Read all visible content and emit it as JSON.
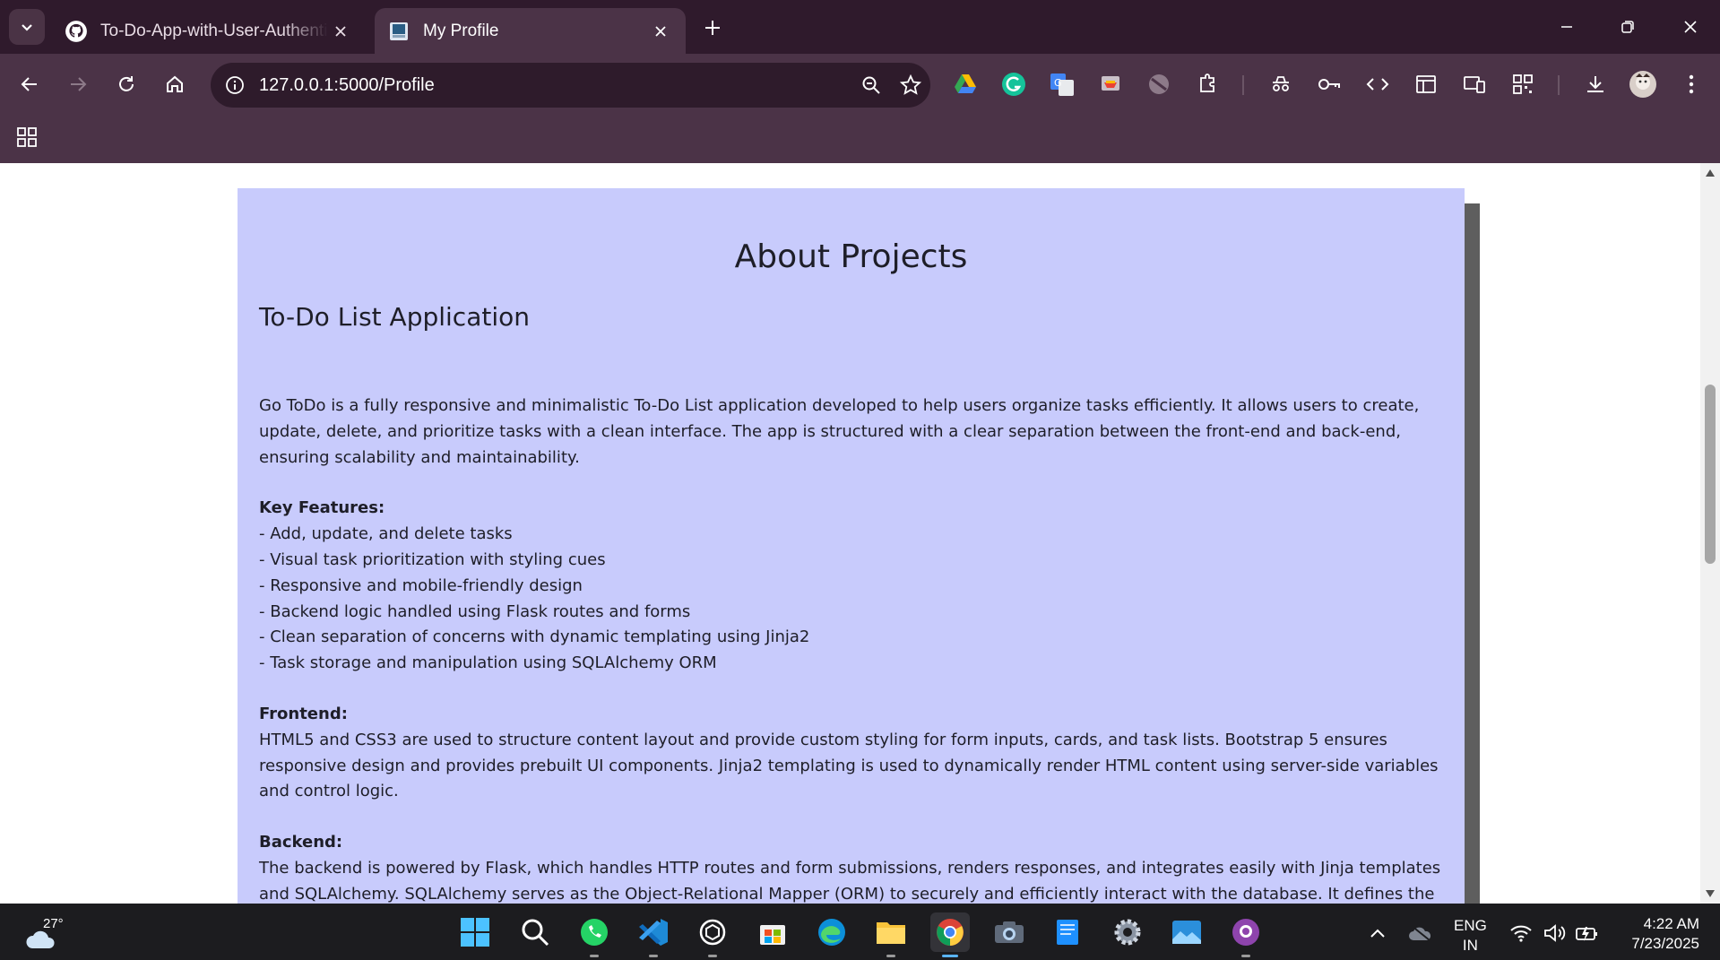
{
  "browser": {
    "tabs": [
      {
        "title": "To-Do-App-with-User-Authentication",
        "favicon": "github-icon",
        "active": false
      },
      {
        "title": "My Profile",
        "favicon": "page-favicon",
        "active": true
      }
    ],
    "url": "127.0.0.1:5000/Profile",
    "extensions": [
      "google-drive-icon",
      "grammarly-icon",
      "google-translate-icon",
      "cast-icon",
      "blocker-icon",
      "extensions-icon",
      "incognito-icon",
      "password-key-icon",
      "code-icon",
      "layout-icon",
      "responsive-icon",
      "qr-code-icon",
      "download-icon",
      "profile-avatar"
    ]
  },
  "page": {
    "heading": "About Projects",
    "project_title": "To-Do List Application",
    "intro": "Go ToDo is a fully responsive and minimalistic To-Do List application developed to help users organize tasks efficiently. It allows users to create, update, delete, and prioritize tasks with a clean interface. The app is structured with a clear separation between the front-end and back-end, ensuring scalability and maintainability.",
    "features_label": "Key Features:",
    "features": [
      "- Add, update, and delete tasks",
      "- Visual task prioritization with styling cues",
      "- Responsive and mobile-friendly design",
      "- Backend logic handled using Flask routes and forms",
      "- Clean separation of concerns with dynamic templating using Jinja2",
      "- Task storage and manipulation using SQLAlchemy ORM"
    ],
    "frontend_label": "Frontend:",
    "frontend_text": "HTML5 and CSS3 are used to structure content layout and provide custom styling for form inputs, cards, and task lists. Bootstrap 5 ensures responsive design and provides prebuilt UI components. Jinja2 templating is used to dynamically render HTML content using server-side variables and control logic.",
    "backend_label": "Backend:",
    "backend_text": "The backend is powered by Flask, which handles HTTP routes and form submissions, renders responses, and integrates easily with Jinja templates and SQLAlchemy. SQLAlchemy serves as the Object-Relational Mapper (ORM) to securely and efficiently interact with the database. It defines the Task model and allows easy CRUD operations using Python code instead of raw SQL."
  },
  "taskbar": {
    "temperature": "27°",
    "apps": [
      "start-icon",
      "search-icon",
      "whatsapp-icon",
      "vscode-icon",
      "chatgpt-icon",
      "store-icon",
      "edge-icon",
      "file-explorer-icon",
      "chrome-icon",
      "camera-icon",
      "notepad-icon",
      "settings-icon",
      "photos-icon",
      "github-desktop-icon"
    ],
    "lang_line1": "ENG",
    "lang_line2": "IN",
    "time": "4:22 AM",
    "date": "7/23/2025"
  },
  "colors": {
    "tabstrip": "#2f1a2c",
    "toolbar": "#4b3347",
    "card_bg": "#c8cbfc",
    "taskbar": "#1c1c1f"
  }
}
